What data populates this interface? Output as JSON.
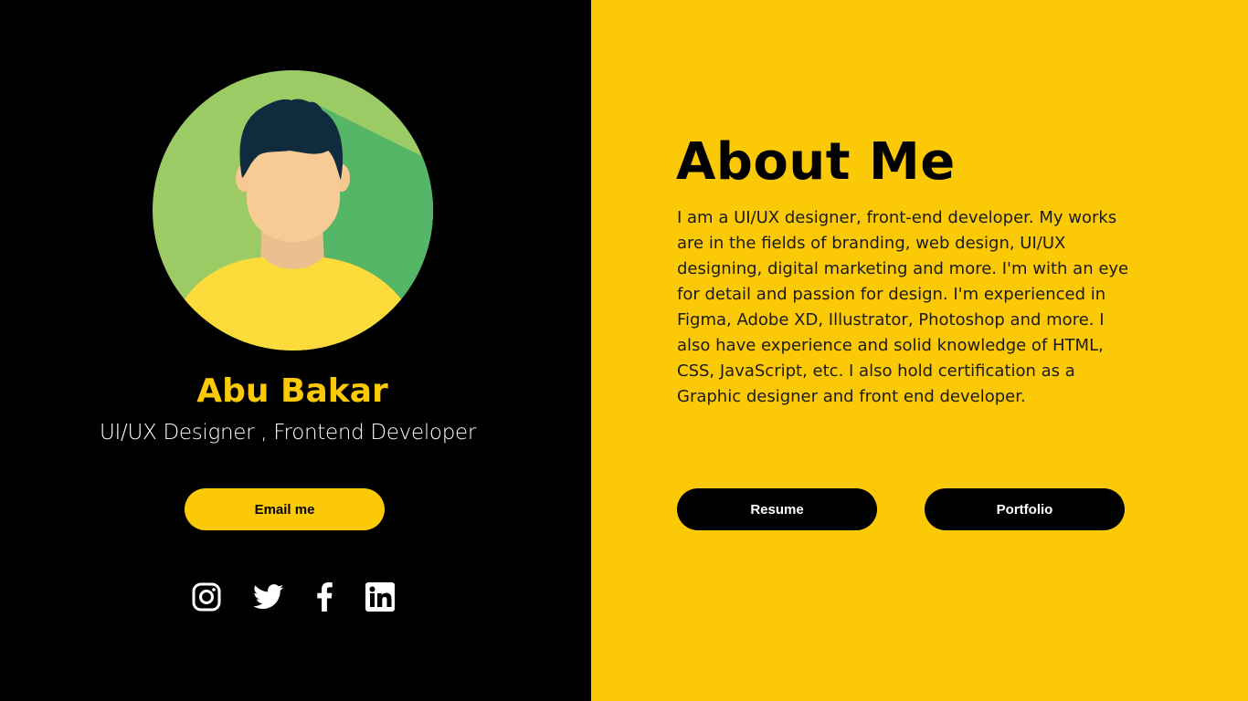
{
  "profile": {
    "name": "Abu Bakar",
    "role": "UI/UX Designer , Frontend Developer",
    "email_button": "Email me"
  },
  "socials": [
    {
      "icon": "instagram-icon"
    },
    {
      "icon": "twitter-icon"
    },
    {
      "icon": "facebook-icon"
    },
    {
      "icon": "linkedin-icon"
    }
  ],
  "about": {
    "title": "About Me",
    "text": "I am a UI/UX designer, front-end developer. My works are in the fields of branding, web design, UI/UX designing, digital marketing and more. I'm with an eye for detail and passion for design. I'm experienced in Figma, Adobe XD, Illustrator, Photoshop and more. I also have experience and solid knowledge of HTML, CSS, JavaScript, etc. I also hold certification as a Graphic designer and front end developer.",
    "resume_button": "Resume",
    "portfolio_button": "Portfolio"
  },
  "colors": {
    "accent": "#FCC907",
    "dark": "#000000",
    "white": "#FFFFFF"
  }
}
